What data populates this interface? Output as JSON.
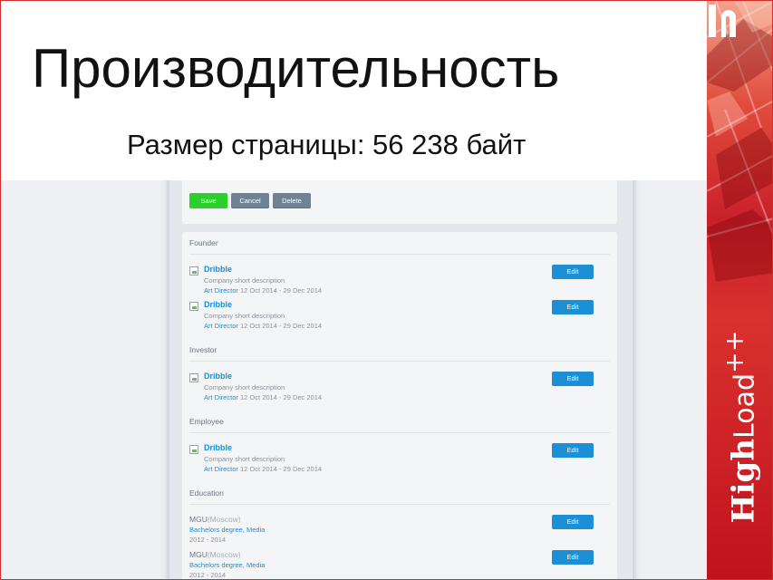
{
  "slide": {
    "title": "Производительность",
    "subtitle": "Размер страницы: 56 238 байт"
  },
  "form_actions": {
    "save_label": "Save",
    "cancel_label": "Cancel",
    "delete_label": "Delete"
  },
  "sections": {
    "founder": "Founder",
    "investor": "Investor",
    "employee": "Employee",
    "education": "Education"
  },
  "entries": [
    {
      "company": "Dribble",
      "description": "Company short description",
      "role": "Art Director",
      "dates": "12 Oct 2014 - 29 Dec 2014",
      "edit": "Edit"
    },
    {
      "company": "Dribble",
      "description": "Company short description",
      "role": "Art Director",
      "dates": "12 Oct 2014 - 29 Dec 2014",
      "edit": "Edit"
    },
    {
      "company": "Dribble",
      "description": "Company short description",
      "role": "Art Director",
      "dates": "12 Oct 2014 - 29 Dec 2014",
      "edit": "Edit"
    },
    {
      "company": "Dribble",
      "description": "Company short description",
      "role": "Art Director",
      "dates": "12 Oct 2014 - 29 Dec 2014",
      "edit": "Edit"
    }
  ],
  "education": [
    {
      "school": "MGU",
      "city": "(Moscow)",
      "degree": "Bachelors degree, Media",
      "years": "2012 - 2014",
      "edit": "Edit"
    },
    {
      "school": "MGU",
      "city": "(Moscow)",
      "degree": "Bachelors degree, Media",
      "years": "2012 - 2014",
      "edit": "Edit"
    }
  ],
  "brand": {
    "logo_word_bold": "High",
    "logo_word_light": "Load",
    "logo_suffix": "++"
  },
  "colors": {
    "accent_blue": "#1d8fd6",
    "save_green": "#2bd12b",
    "brand_red": "#c8202a"
  }
}
